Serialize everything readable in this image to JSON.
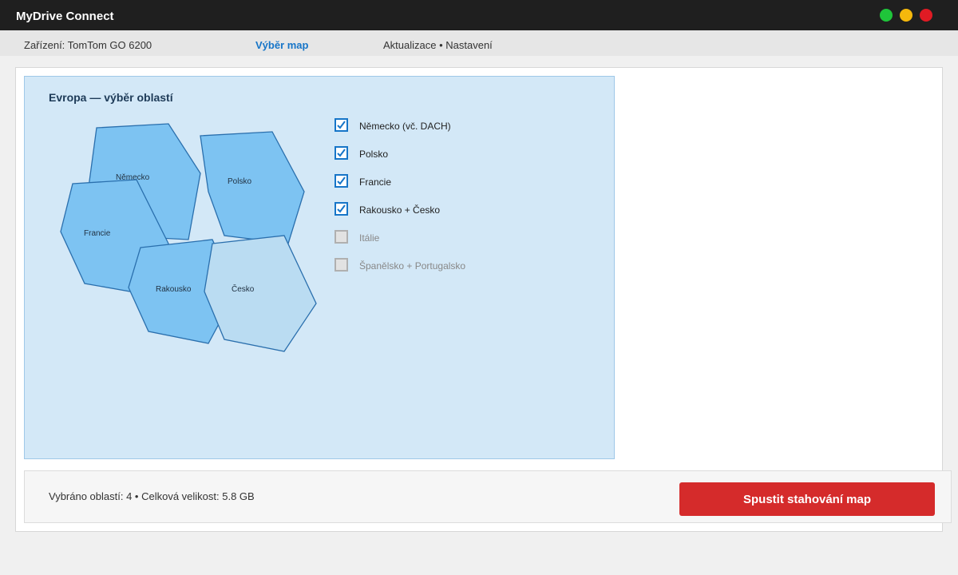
{
  "app": {
    "title": "MyDrive Connect",
    "window_controls": [
      "green-dot",
      "yellow-dot",
      "red-dot"
    ],
    "colors": {
      "titlebar": "#1f1f1f",
      "accent": "#1675c8",
      "primary_button": "#d52b2b"
    }
  },
  "nav": {
    "device": "Zařízení: TomTom GO 6200",
    "maps": "Výběr map",
    "updates": "Aktualizace • Nastavení"
  },
  "map": {
    "title": "Evropa — výběr oblastí",
    "regions": [
      {
        "label": "Německo",
        "selected": true
      },
      {
        "label": "Polsko",
        "selected": true
      },
      {
        "label": "Francie",
        "selected": true
      },
      {
        "label": "Rakousko",
        "selected": true
      },
      {
        "label": "Česko",
        "selected": true
      }
    ]
  },
  "region_list": [
    {
      "label": "Německo (vč. DACH)",
      "checked": true,
      "enabled": true
    },
    {
      "label": "Polsko",
      "checked": true,
      "enabled": true
    },
    {
      "label": "Francie",
      "checked": true,
      "enabled": true
    },
    {
      "label": "Rakousko + Česko",
      "checked": true,
      "enabled": true
    },
    {
      "label": "Itálie",
      "checked": false,
      "enabled": false
    },
    {
      "label": "Španělsko + Portugalsko",
      "checked": false,
      "enabled": false
    }
  ],
  "footer": {
    "summary": "Vybráno oblastí: 4 • Celková velikost: 5.8 GB",
    "download_label": "Spustit stahování map"
  }
}
